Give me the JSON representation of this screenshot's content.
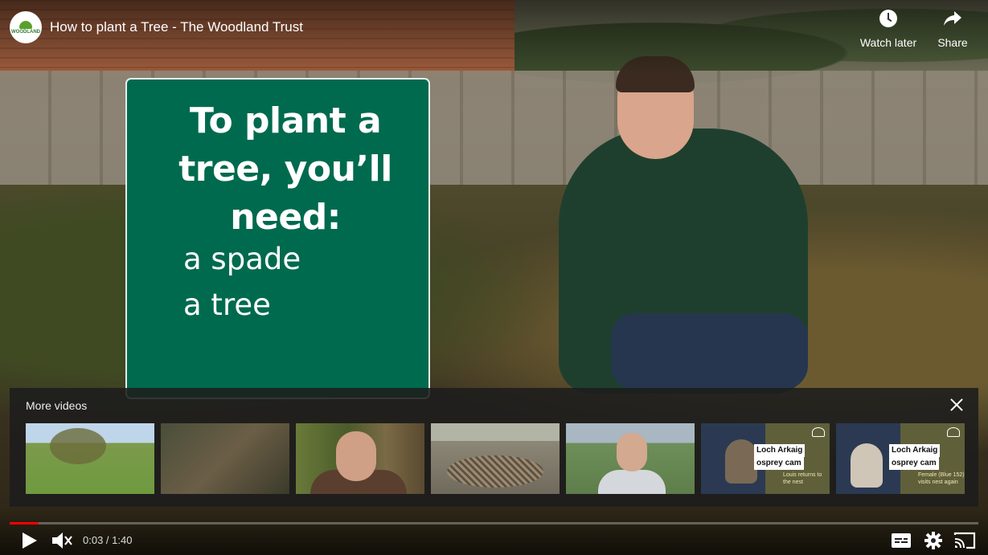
{
  "video": {
    "title": "How to plant a Tree - The Woodland Trust",
    "channel_logo_text": "WOODLAND",
    "sign": {
      "title": "To plant a tree, you’ll need:",
      "items": [
        "a spade",
        "a tree"
      ]
    }
  },
  "top_actions": {
    "watch_later": "Watch later",
    "share": "Share"
  },
  "more_videos": {
    "title": "More videos",
    "thumbnails": [
      {
        "id": "t1",
        "tag1": "",
        "tag2": "",
        "note": ""
      },
      {
        "id": "t2",
        "tag1": "",
        "tag2": "",
        "note": ""
      },
      {
        "id": "t3",
        "tag1": "",
        "tag2": "",
        "note": ""
      },
      {
        "id": "t4",
        "tag1": "",
        "tag2": "",
        "note": ""
      },
      {
        "id": "t5",
        "tag1": "",
        "tag2": "",
        "note": ""
      },
      {
        "id": "t6",
        "tag1": "Loch Arkaig",
        "tag2": "osprey cam",
        "note": "Louis returns to the nest"
      },
      {
        "id": "t7",
        "tag1": "Loch Arkaig",
        "tag2": "osprey cam",
        "note": "Female (Blue 152) visits nest again"
      }
    ]
  },
  "player": {
    "current_time": "0:03",
    "separator": " / ",
    "duration": "1:40",
    "progress_fraction": 0.03,
    "accent_color": "#ff0000"
  },
  "icons": {
    "play": "play-icon",
    "mute": "volume-muted-icon",
    "captions": "captions-icon",
    "settings": "gear-icon",
    "cast": "cast-icon",
    "watch_later": "clock-icon",
    "share": "share-arrow-icon",
    "close": "close-icon"
  }
}
